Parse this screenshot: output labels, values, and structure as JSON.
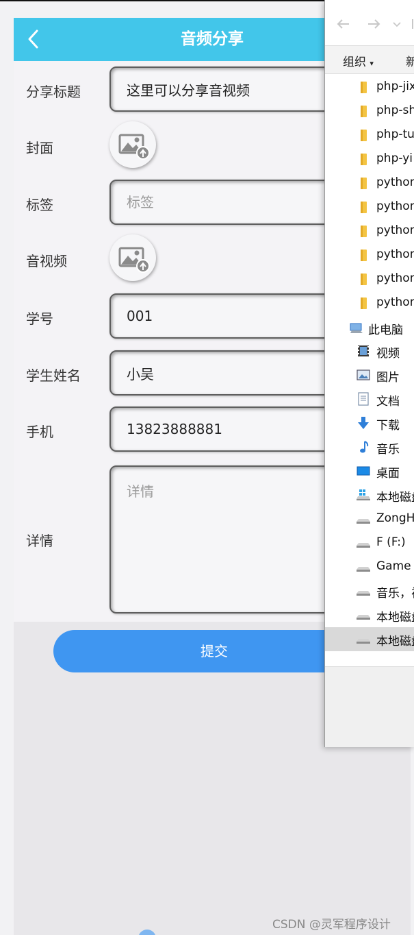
{
  "app": {
    "header": {
      "title": "音频分享",
      "back_icon": "chevron-left-icon"
    },
    "form": {
      "title": {
        "label": "分享标题",
        "value": "这里可以分享音视频",
        "placeholder": ""
      },
      "cover": {
        "label": "封面",
        "icon": "image-upload-icon"
      },
      "tags": {
        "label": "标签",
        "value": "",
        "placeholder": "标签"
      },
      "media": {
        "label": "音视频",
        "icon": "image-upload-icon"
      },
      "student_id": {
        "label": "学号",
        "value": "001",
        "placeholder": ""
      },
      "student_name": {
        "label": "学生姓名",
        "value": "小吴",
        "placeholder": ""
      },
      "phone": {
        "label": "手机",
        "value": "13823888881",
        "placeholder": ""
      },
      "details": {
        "label": "详情",
        "value": "",
        "placeholder": "详情"
      }
    },
    "submit_label": "提交",
    "colors": {
      "header": "#42c6ea",
      "submit": "#3f96f1"
    }
  },
  "explorer": {
    "toolbar": {
      "organize": "组织",
      "new": "新"
    },
    "folders": [
      "php-jix",
      "php-sh",
      "php-tu",
      "php-yi",
      "python",
      "python",
      "python",
      "python",
      "python",
      "python"
    ],
    "this_pc": "此电脑",
    "libraries": [
      {
        "label": "视频",
        "icon": "video-icon"
      },
      {
        "label": "图片",
        "icon": "picture-icon"
      },
      {
        "label": "文档",
        "icon": "document-icon"
      },
      {
        "label": "下载",
        "icon": "download-icon"
      },
      {
        "label": "音乐",
        "icon": "music-icon"
      },
      {
        "label": "桌面",
        "icon": "desktop-icon"
      }
    ],
    "drives": [
      "本地磁盘",
      "ZongH",
      "F (F:)",
      "Game (",
      "音乐，视",
      "本地磁盘",
      "本地磁盘"
    ]
  },
  "watermark": "CSDN @灵军程序设计"
}
